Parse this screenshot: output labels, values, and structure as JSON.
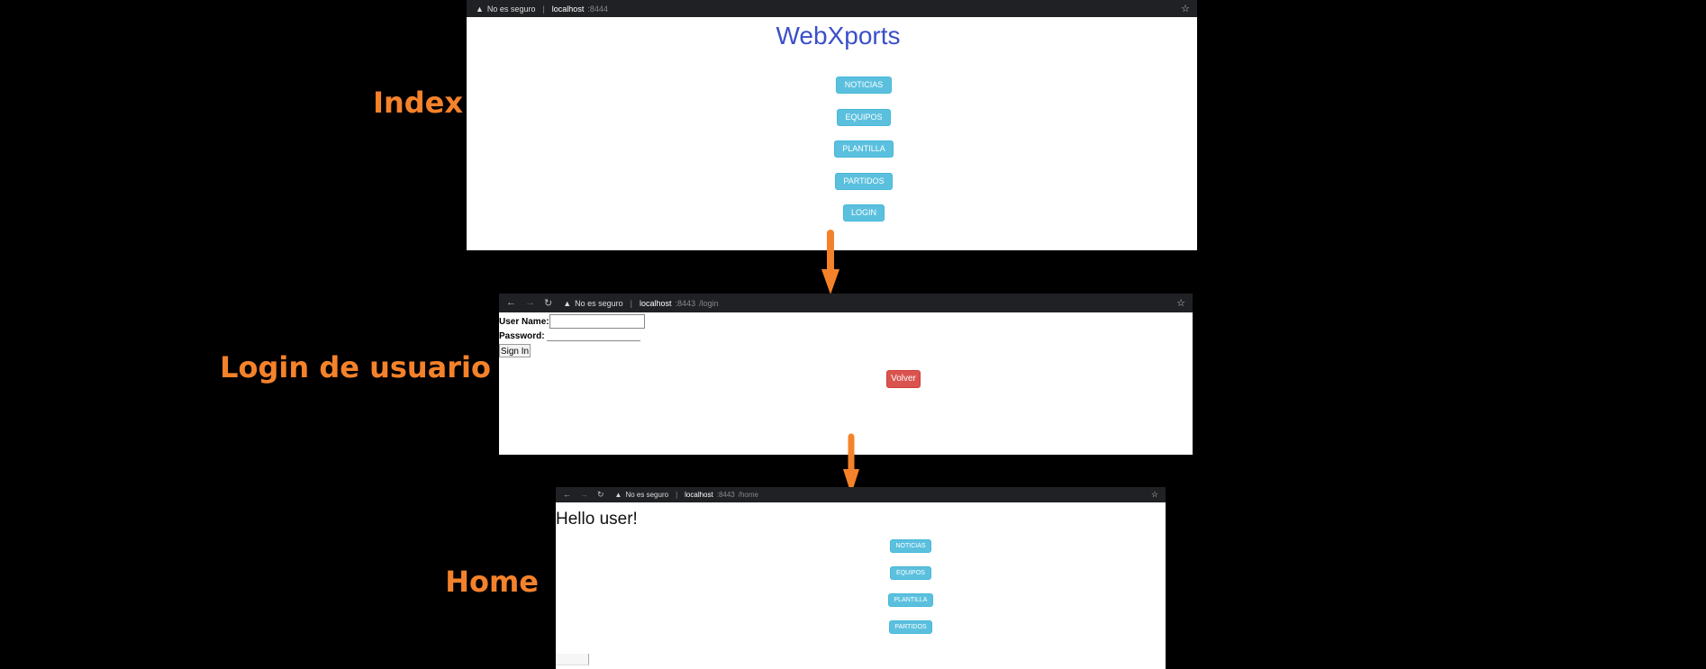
{
  "labels": {
    "index": "Index",
    "login": "Login de usuario",
    "home": "Home"
  },
  "index_window": {
    "address": {
      "warning": "No es seguro",
      "host": "localhost",
      "port": ":8444",
      "path": ""
    },
    "title": "WebXports",
    "buttons": [
      "NOTICIAS",
      "EQUIPOS",
      "PLANTILLA",
      "PARTIDOS",
      "LOGIN"
    ]
  },
  "login_window": {
    "address": {
      "warning": "No es seguro",
      "host": "localhost",
      "port": ":8443",
      "path": "/login"
    },
    "user_label": "User Name:",
    "password_label": "Password:",
    "signin_label": "Sign In",
    "back_label": "Volver"
  },
  "home_window": {
    "address": {
      "warning": "No es seguro",
      "host": "localhost",
      "port": ":8443",
      "path": "/home"
    },
    "greeting": "Hello user!",
    "buttons": [
      "NOTICIAS",
      "EQUIPOS",
      "PLANTILLA",
      "PARTIDOS"
    ]
  },
  "colors": {
    "accent": "#f5822a",
    "info": "#5bc0de",
    "danger": "#d9534f",
    "title": "#3a4fc9"
  }
}
